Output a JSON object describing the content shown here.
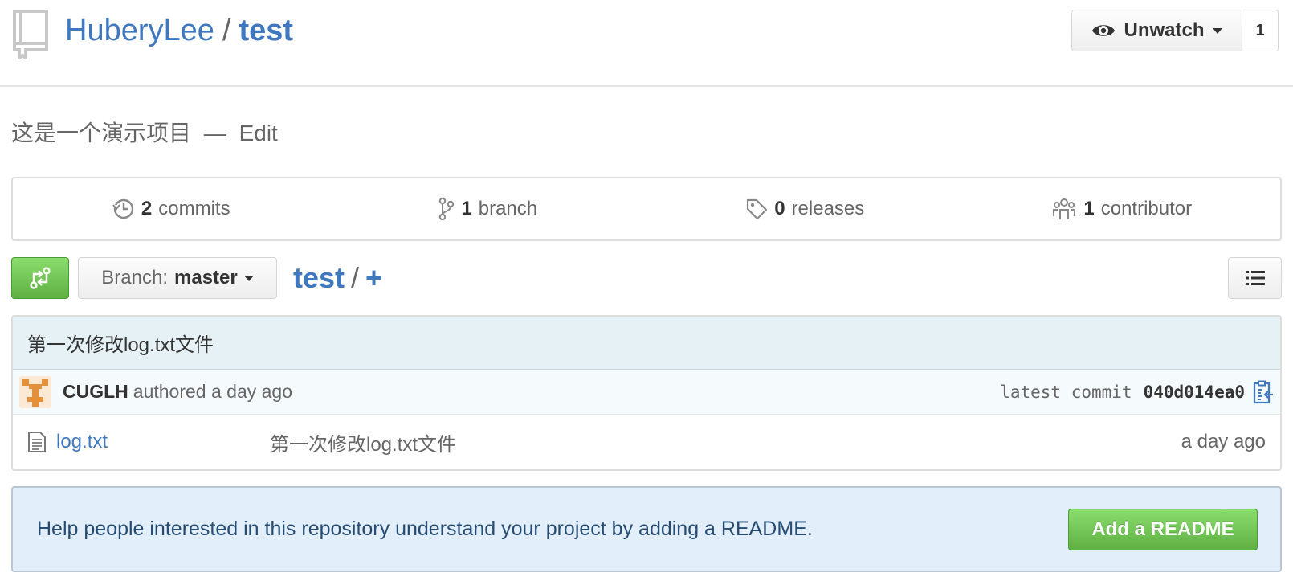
{
  "header": {
    "owner": "HuberyLee",
    "separator": "/",
    "repo_name": "test",
    "watch": {
      "label": "Unwatch",
      "count": "1"
    }
  },
  "description": {
    "text": "这是一个演示项目",
    "dash": "—",
    "edit_label": "Edit"
  },
  "summary": {
    "commits": {
      "count": "2",
      "label": "commits",
      "icon": "history-icon"
    },
    "branches": {
      "count": "1",
      "label": "branch",
      "icon": "git-branch-icon"
    },
    "releases": {
      "count": "0",
      "label": "releases",
      "icon": "tag-icon"
    },
    "contributors": {
      "count": "1",
      "label": "contributor",
      "icon": "organization-icon"
    }
  },
  "file_nav": {
    "branch_prefix": "Branch:",
    "branch_name": "master",
    "breadcrumb_root": "test",
    "breadcrumb_sep": "/",
    "breadcrumb_add": "+"
  },
  "commit": {
    "message": "第一次修改log.txt文件",
    "author": "CUGLH",
    "authored": "authored a day ago",
    "latest_label": "latest commit",
    "sha": "040d014ea0"
  },
  "files": [
    {
      "name": "log.txt",
      "message": "第一次修改log.txt文件",
      "age": "a day ago"
    }
  ],
  "readme_prompt": {
    "text": "Help people interested in this repository understand your project by adding a README.",
    "button": "Add a README"
  },
  "colors": {
    "link": "#4078c0",
    "primary_green": "#60b044",
    "commit_header_bg": "#e6f1f6",
    "readme_bg": "#e2eef9"
  }
}
